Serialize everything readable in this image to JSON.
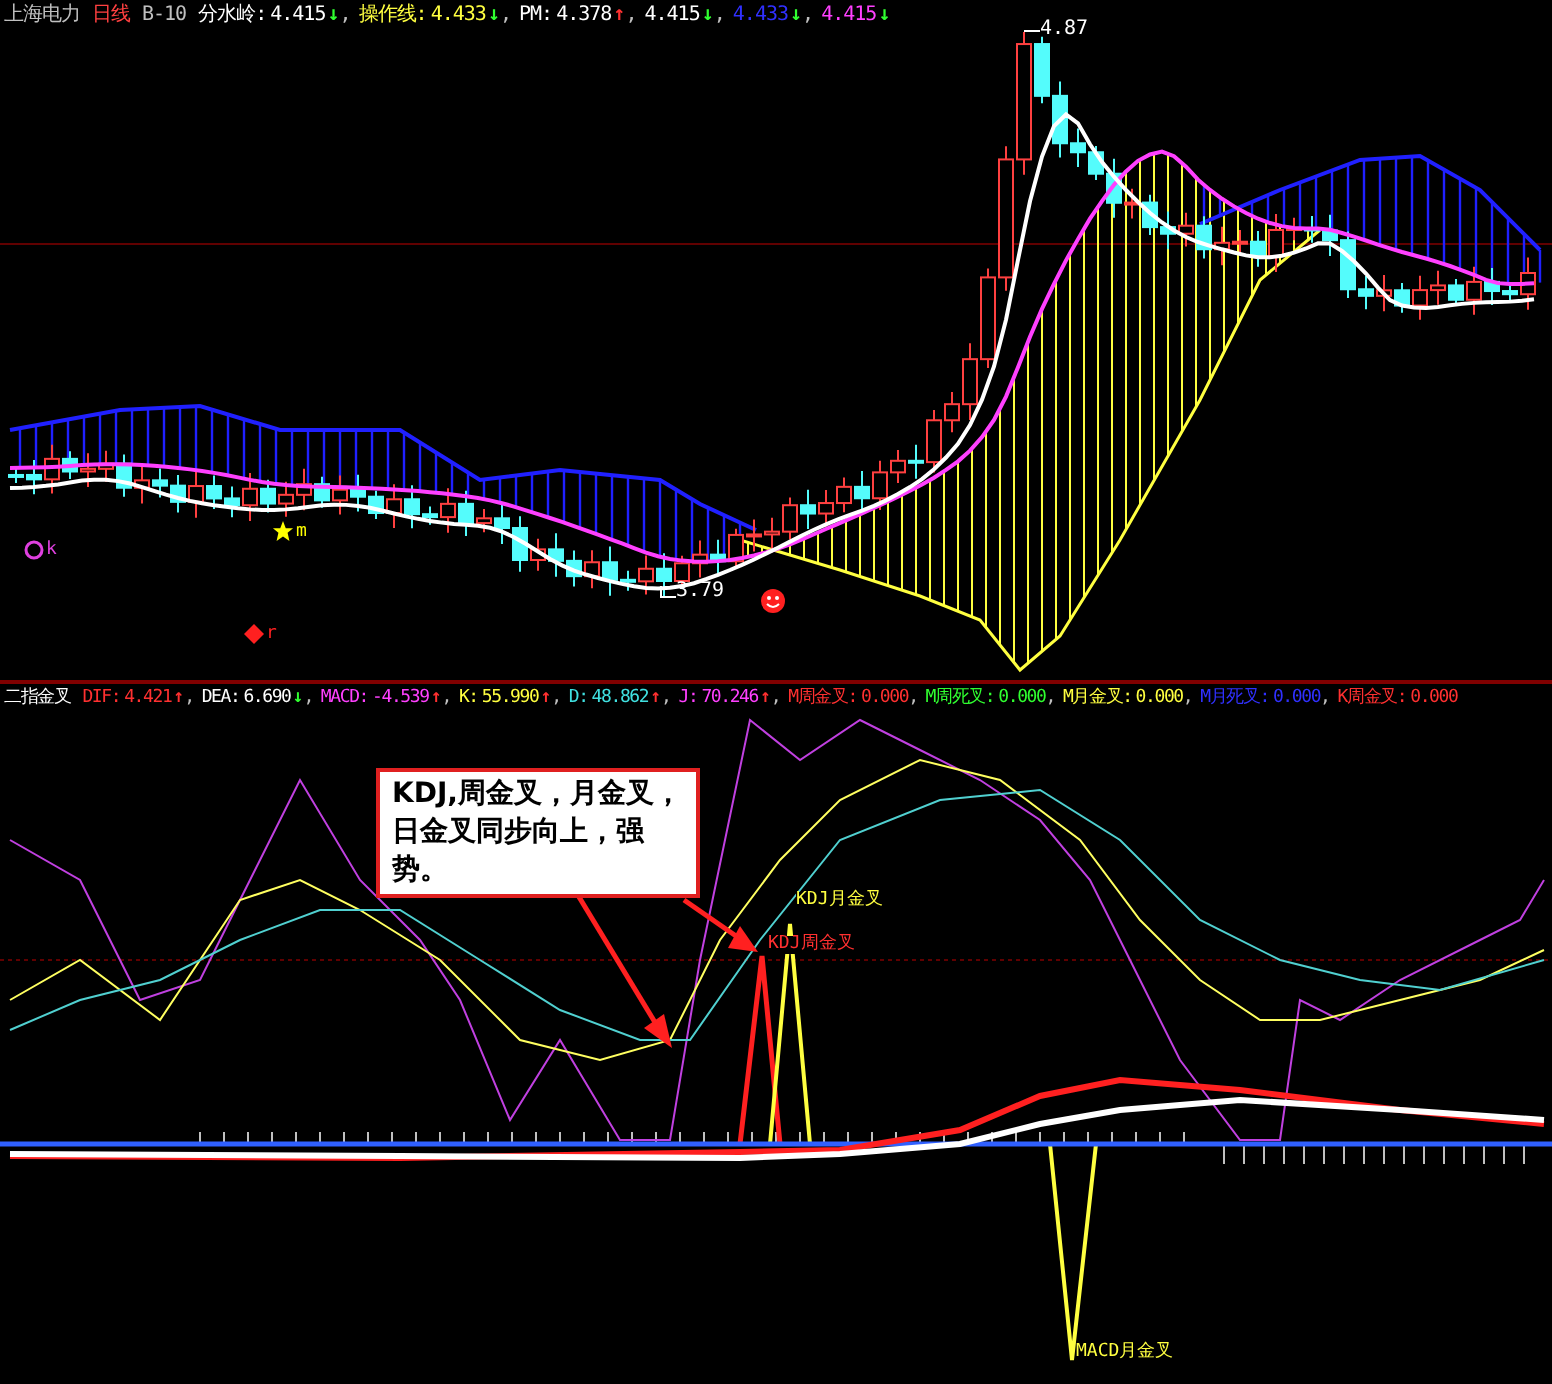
{
  "main_panel": {
    "separator": ",",
    "legend": [
      {
        "text": "上海电力",
        "color": "#c0c0c0"
      },
      {
        "text": "日线",
        "color": "#ff4040"
      },
      {
        "text": "B-10",
        "color": "#c0c0c0"
      },
      {
        "label": "分水岭:",
        "value": "4.415",
        "arrow": {
          "text": "↓",
          "color": "#30ff30"
        },
        "color": "#ffffff"
      },
      {
        "label": "操作线:",
        "value": "4.433",
        "arrow": {
          "text": "↓",
          "color": "#30ff30"
        },
        "color": "#ffff40"
      },
      {
        "label": "PM:",
        "value": "4.378",
        "arrow": {
          "text": "↑",
          "color": "#ff3030"
        },
        "color": "#ffffff"
      },
      {
        "value": "4.415",
        "arrow": {
          "text": "↓",
          "color": "#30ff30"
        },
        "color": "#ffffff"
      },
      {
        "value": "4.433",
        "arrow": {
          "text": "↓",
          "color": "#30ff30"
        },
        "color": "#3030ff"
      },
      {
        "value": "4.415",
        "arrow": {
          "text": "↓",
          "color": "#30ff30"
        },
        "color": "#ff40ff"
      }
    ],
    "markers": [
      {
        "kind": "circle",
        "letter": "k",
        "color": "#e040e0"
      },
      {
        "kind": "star",
        "letter": "m",
        "color": "#ffff00"
      },
      {
        "kind": "diamond",
        "letter": "r",
        "color": "#ff2020"
      },
      {
        "kind": "smiley"
      }
    ],
    "price_labels": [
      "3.79",
      "4.87"
    ]
  },
  "indicator_panel": {
    "separator": ",",
    "legend": [
      {
        "text": "二指金叉",
        "color": "#ffffff"
      },
      {
        "label": "DIF:",
        "value": "4.421",
        "arrow": {
          "text": "↑",
          "color": "#ff3030"
        },
        "color": "#ff3030"
      },
      {
        "label": "DEA:",
        "value": "6.690",
        "arrow": {
          "text": "↓",
          "color": "#30ff30"
        },
        "color": "#ffffff"
      },
      {
        "label": "MACD:",
        "value": "-4.539",
        "arrow": {
          "text": "↑",
          "color": "#ff3030"
        },
        "color": "#ff40ff"
      },
      {
        "label": "K:",
        "value": "55.990",
        "arrow": {
          "text": "↑",
          "color": "#ff3030"
        },
        "color": "#ffff40"
      },
      {
        "label": "D:",
        "value": "48.862",
        "arrow": {
          "text": "↑",
          "color": "#ff3030"
        },
        "color": "#40e0e0"
      },
      {
        "label": "J:",
        "value": "70.246",
        "arrow": {
          "text": "↑",
          "color": "#ff3030"
        },
        "color": "#ff40ff"
      },
      {
        "label": "M周金叉:",
        "value": "0.000",
        "color": "#ff3030"
      },
      {
        "label": "M周死叉:",
        "value": "0.000",
        "color": "#30ff30"
      },
      {
        "label": "M月金叉:",
        "value": "0.000",
        "color": "#ffff40"
      },
      {
        "label": "M月死叉:",
        "value": "0.000",
        "color": "#3030ff"
      },
      {
        "label": "K周金叉:",
        "value": "0.000",
        "color": "#ff3030"
      }
    ],
    "callout": "KDJ,周金叉，月金叉，日金叉同步向上，强势。",
    "signal_labels": [
      {
        "text": "KDJ月金叉",
        "color": "#ffff40"
      },
      {
        "text": "KDJ周金叉",
        "color": "#ff3030"
      },
      {
        "text": "MACD月金叉",
        "color": "#ffff40"
      }
    ]
  }
}
